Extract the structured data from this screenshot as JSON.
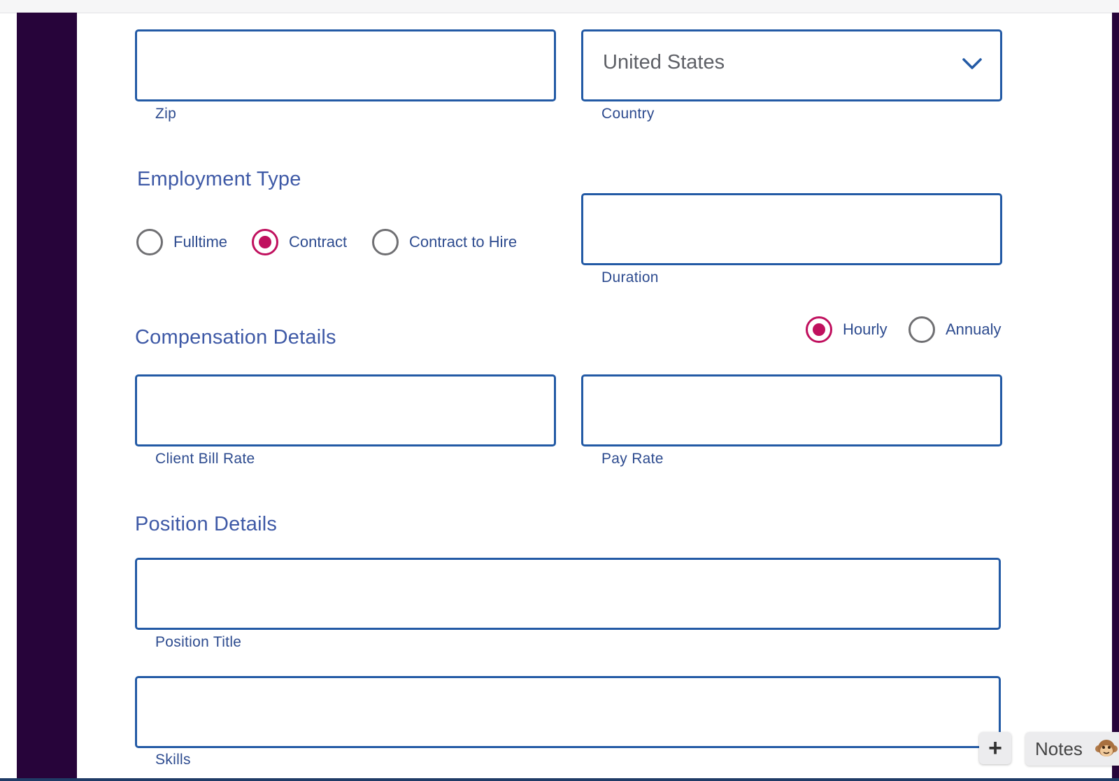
{
  "address": {
    "zip": {
      "label": "Zip",
      "value": ""
    },
    "country": {
      "label": "Country",
      "value": "United States"
    }
  },
  "employment": {
    "title": "Employment Type",
    "options": [
      {
        "label": "Fulltime",
        "checked": false
      },
      {
        "label": "Contract",
        "checked": true
      },
      {
        "label": "Contract to Hire",
        "checked": false
      }
    ],
    "duration": {
      "label": "Duration",
      "value": ""
    }
  },
  "compensation": {
    "title": "Compensation Details",
    "rate_types": [
      {
        "label": "Hourly",
        "checked": true
      },
      {
        "label": "Annualy",
        "checked": false
      }
    ],
    "client_bill_rate": {
      "label": "Client Bill Rate",
      "value": ""
    },
    "pay_rate": {
      "label": "Pay Rate",
      "value": ""
    }
  },
  "position": {
    "title": "Position Details",
    "position_title": {
      "label": "Position Title",
      "value": ""
    },
    "skills": {
      "label": "Skills",
      "value": ""
    }
  },
  "floating": {
    "add_label": "+",
    "notes_label": "Notes"
  },
  "colors": {
    "field_border": "#235aa5",
    "label_text": "#2d4b8f",
    "radio_selected": "#c0105e",
    "sidebar": "#27043a"
  }
}
